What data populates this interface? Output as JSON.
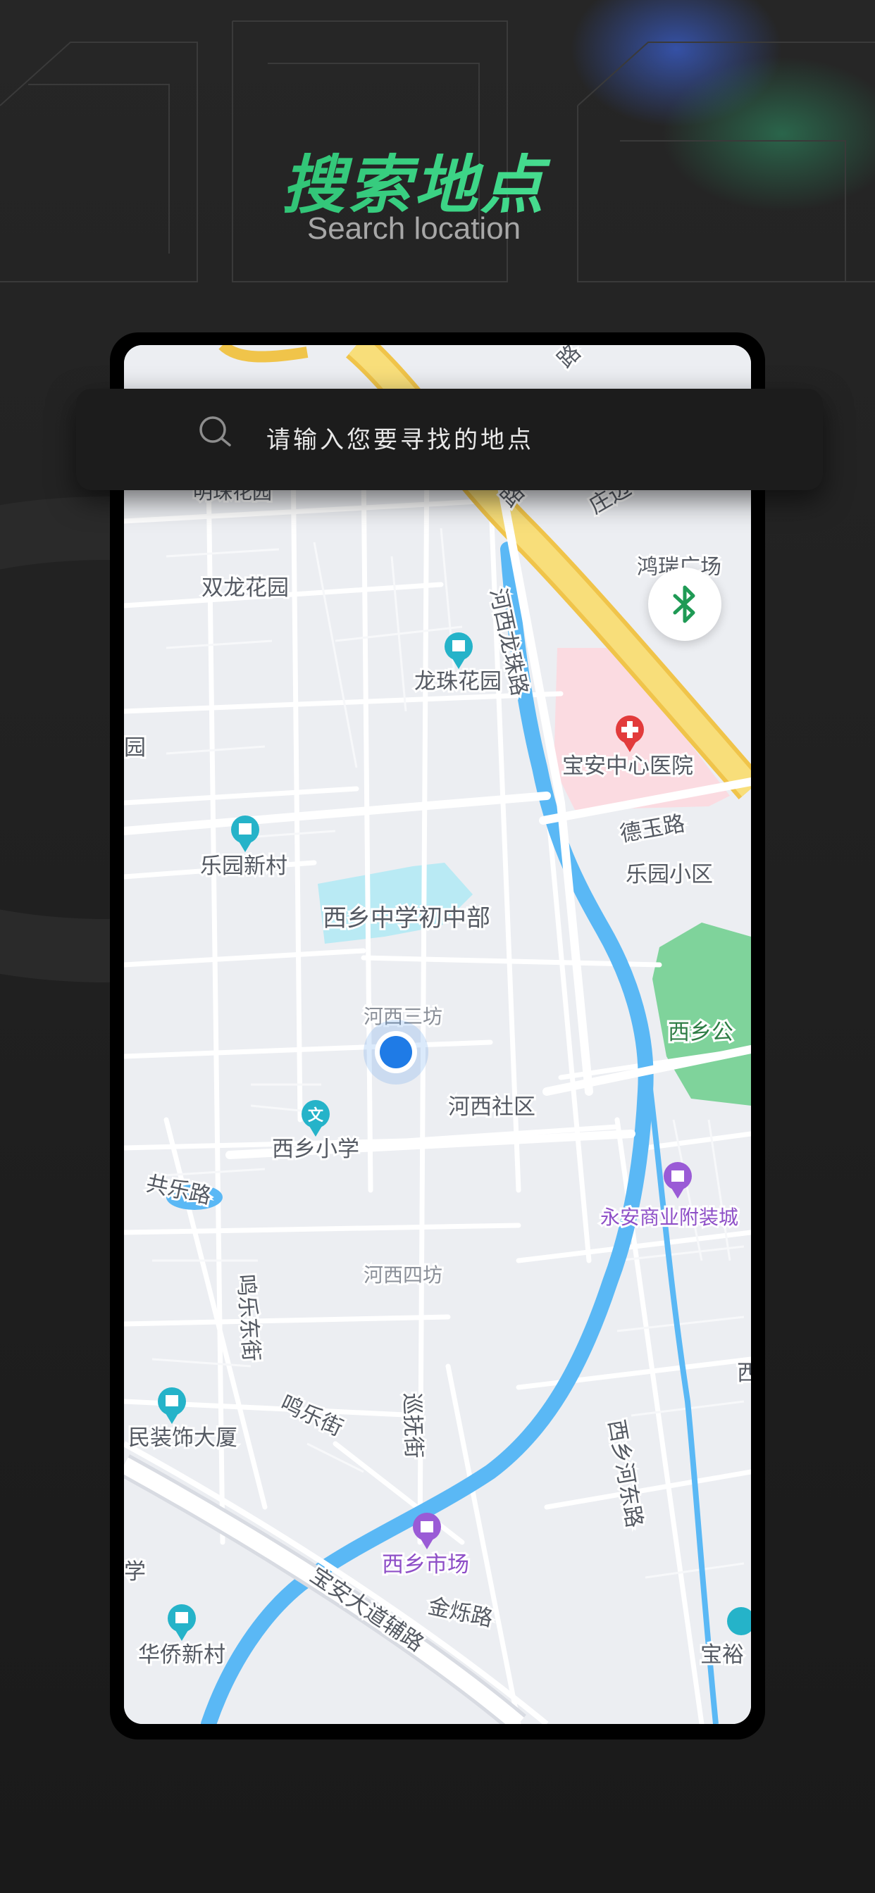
{
  "header": {
    "title": "搜索地点",
    "subtitle": "Search location"
  },
  "search": {
    "placeholder": "请输入您要寻找的地点",
    "value": ""
  },
  "map": {
    "labels": {
      "mingzhu": "明珠花园",
      "shuanglong": "双龙花园",
      "longzhu": "龙珠花园",
      "hexi_longzhu_road": "河西龙珠路",
      "baoan_hospital": "宝安中心医院",
      "deyu_road": "德玉路",
      "leyuan_xiaoqu": "乐园小区",
      "leyuan_xincun": "乐园新村",
      "xixiang_middle": "西乡中学初中部",
      "hexi_sanfang": "河西三坊",
      "hexi_shequ": "河西社区",
      "xixiang_park": "西乡公",
      "xixiang_primary": "西乡小学",
      "gongle_road": "共乐路",
      "yongan_mall": "永安商业附装城",
      "hexi_sifang": "河西四坊",
      "mingle_dongjie": "鸣乐东街",
      "mingle_jie": "鸣乐街",
      "xunfu_jie": "巡抚街",
      "xixiang_hedong_road": "西乡河东路",
      "minzhuang_building": "民装饰大厦",
      "xixiang_market": "西乡市场",
      "jinshuo_road": "金烁路",
      "baoan_avenue_aux": "宝安大道辅路",
      "huaqiao_xincun": "华侨新村",
      "baoyu": "宝裕",
      "hongrui_plaza": "鸿瑞广场",
      "zhuang": "庄边",
      "yuan": "园",
      "xue": "学",
      "xi": "西",
      "lu_top": "路",
      "lu_hospital": "路"
    }
  },
  "colors": {
    "accent_green": "#2fc87a",
    "location_blue": "#1f7be6",
    "river_blue": "#5ab8f5",
    "highway_yellow": "#f5d35a",
    "poi_teal": "#25b3c9",
    "poi_red": "#e23b3b",
    "poi_purple": "#9a5bd6",
    "park_green": "#7fd39b",
    "school_cyan": "#b9eaf4"
  },
  "icons": {
    "search": "search-icon",
    "bluetooth": "bluetooth-icon",
    "current_location": "location-dot-icon"
  }
}
